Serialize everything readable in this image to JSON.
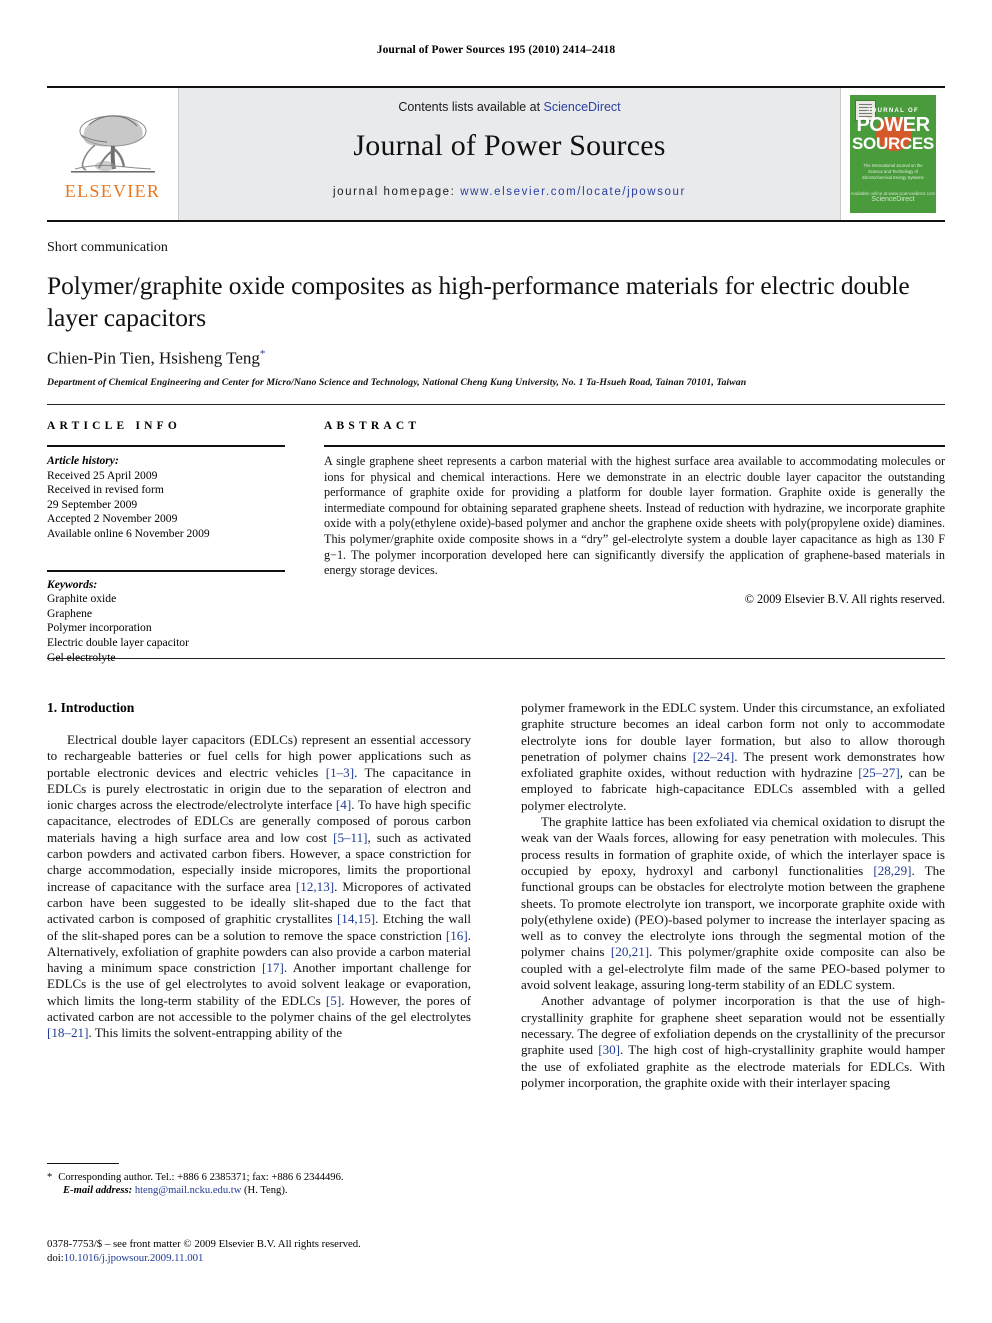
{
  "running_head": "Journal of Power Sources 195 (2010) 2414–2418",
  "masthead": {
    "contents_prefix": "Contents lists available at ",
    "sciencedirect": "ScienceDirect",
    "journal_title": "Journal of Power Sources",
    "homepage_label": "journal homepage:",
    "homepage_url": "www.elsevier.com/locate/jpowsour",
    "publisher": "ELSEVIER",
    "cover": {
      "line1": "JOURNAL OF",
      "line2": "POWER",
      "line3": "SOURCES",
      "subtitle": "The International Journal on the Science and Technology of Electrochemical Energy Systems",
      "footer_big": "ScienceDirect",
      "footer_small": "Available online at www.sciencedirect.com"
    },
    "accent_blue": "#2b3fa0",
    "elsevier_orange": "#E87722",
    "cover_green": "#4a9b3c"
  },
  "article": {
    "type": "Short communication",
    "title": "Polymer/graphite oxide composites as high-performance materials for electric double layer capacitors",
    "authors": "Chien-Pin Tien, Hsisheng Teng",
    "author_marker": "*",
    "affiliation": "Department of Chemical Engineering and Center for Micro/Nano Science and Technology, National Cheng Kung University, No. 1 Ta-Hsueh Road, Tainan 70101, Taiwan"
  },
  "article_info": {
    "heading": "ARTICLE INFO",
    "history_label": "Article history:",
    "history": [
      "Received 25 April 2009",
      "Received in revised form",
      "29 September 2009",
      "Accepted 2 November 2009",
      "Available online 6 November 2009"
    ],
    "keywords_label": "Keywords:",
    "keywords": [
      "Graphite oxide",
      "Graphene",
      "Polymer incorporation",
      "Electric double layer capacitor",
      "Gel electrolyte"
    ]
  },
  "abstract": {
    "heading": "ABSTRACT",
    "text": "A single graphene sheet represents a carbon material with the highest surface area available to accommodating molecules or ions for physical and chemical interactions. Here we demonstrate in an electric double layer capacitor the outstanding performance of graphite oxide for providing a platform for double layer formation. Graphite oxide is generally the intermediate compound for obtaining separated graphene sheets. Instead of reduction with hydrazine, we incorporate graphite oxide with a poly(ethylene oxide)-based polymer and anchor the graphene oxide sheets with poly(propylene oxide) diamines. This polymer/graphite oxide composite shows in a “dry” gel-electrolyte system a double layer capacitance as high as 130 F g−1. The polymer incorporation developed here can significantly diversify the application of graphene-based materials in energy storage devices.",
    "copyright": "© 2009 Elsevier B.V. All rights reserved."
  },
  "body": {
    "section_heading": "1. Introduction",
    "left_para_1_a": "Electrical double layer capacitors (EDLCs) represent an essential accessory to rechargeable batteries or fuel cells for high power applications such as portable electronic devices and electric vehicles ",
    "left_ref_1": "[1–3]",
    "left_para_1_b": ". The capacitance in EDLCs is purely electrostatic in origin due to the separation of electron and ionic charges across the electrode/electrolyte interface ",
    "left_ref_2": "[4]",
    "left_para_1_c": ". To have high specific capacitance, electrodes of EDLCs are generally composed of porous carbon materials having a high surface area and low cost ",
    "left_ref_3": "[5–11]",
    "left_para_1_d": ", such as activated carbon powders and activated carbon fibers. However, a space constriction for charge accommodation, especially inside micropores, limits the proportional increase of capacitance with the surface area ",
    "left_ref_4": "[12,13]",
    "left_para_1_e": ". Micropores of activated carbon have been suggested to be ideally slit-shaped due to the fact that activated carbon is composed of graphitic crystallites ",
    "left_ref_5": "[14,15]",
    "left_para_1_f": ". Etching the wall of the slit-shaped pores can be a solution to remove the space constriction ",
    "left_ref_6": "[16]",
    "left_para_1_g": ". Alternatively, exfoliation of graphite powders can also provide a carbon material having a minimum space constriction ",
    "left_ref_7": "[17]",
    "left_para_1_h": ". Another important challenge for EDLCs is the use of gel electrolytes to avoid solvent leakage or evaporation, which limits the long-term stability of the EDLCs ",
    "left_ref_8": "[5]",
    "left_para_1_i": ". However, the pores of activated carbon are not accessible to the polymer chains of the gel electrolytes ",
    "left_ref_9": "[18–21]",
    "left_para_1_j": ". This limits the solvent-entrapping ability of the",
    "right_para_1_a": "polymer framework in the EDLC system. Under this circumstance, an exfoliated graphite structure becomes an ideal carbon form not only to accommodate electrolyte ions for double layer formation, but also to allow thorough penetration of polymer chains ",
    "right_ref_1": "[22–24]",
    "right_para_1_b": ". The present work demonstrates how exfoliated graphite oxides, without reduction with hydrazine ",
    "right_ref_2": "[25–27]",
    "right_para_1_c": ", can be employed to fabricate high-capacitance EDLCs assembled with a gelled polymer electrolyte.",
    "right_para_2_a": "The graphite lattice has been exfoliated via chemical oxidation to disrupt the weak van der Waals forces, allowing for easy penetration with molecules. This process results in formation of graphite oxide, of which the interlayer space is occupied by epoxy, hydroxyl and carbonyl functionalities ",
    "right_ref_3": "[28,29]",
    "right_para_2_b": ". The functional groups can be obstacles for electrolyte motion between the graphene sheets. To promote electrolyte ion transport, we incorporate graphite oxide with poly(ethylene oxide) (PEO)-based polymer to increase the interlayer spacing as well as to convey the electrolyte ions through the segmental motion of the polymer chains ",
    "right_ref_4": "[20,21]",
    "right_para_2_c": ". This polymer/graphite oxide composite can also be coupled with a gel-electrolyte film made of the same PEO-based polymer to avoid solvent leakage, assuring long-term stability of an EDLC system.",
    "right_para_3_a": "Another advantage of polymer incorporation is that the use of high-crystallinity graphite for graphene sheet separation would not be essentially necessary. The degree of exfoliation depends on the crystallinity of the precursor graphite used ",
    "right_ref_5": "[30]",
    "right_para_3_b": ". The high cost of high-crystallinity graphite would hamper the use of exfoliated graphite as the electrode materials for EDLCs. With polymer incorporation, the graphite oxide with their interlayer spacing"
  },
  "footnotes": {
    "corresponding_star": "*",
    "corresponding": "Corresponding author. Tel.: +886 6 2385371; fax: +886 6 2344496.",
    "email_label": "E-mail address:",
    "email": "hteng@mail.ncku.edu.tw",
    "email_suffix": "(H. Teng).",
    "issn_line": "0378-7753/$ – see front matter © 2009 Elsevier B.V. All rights reserved.",
    "doi_label": "doi:",
    "doi": "10.1016/j.jpowsour.2009.11.001"
  }
}
